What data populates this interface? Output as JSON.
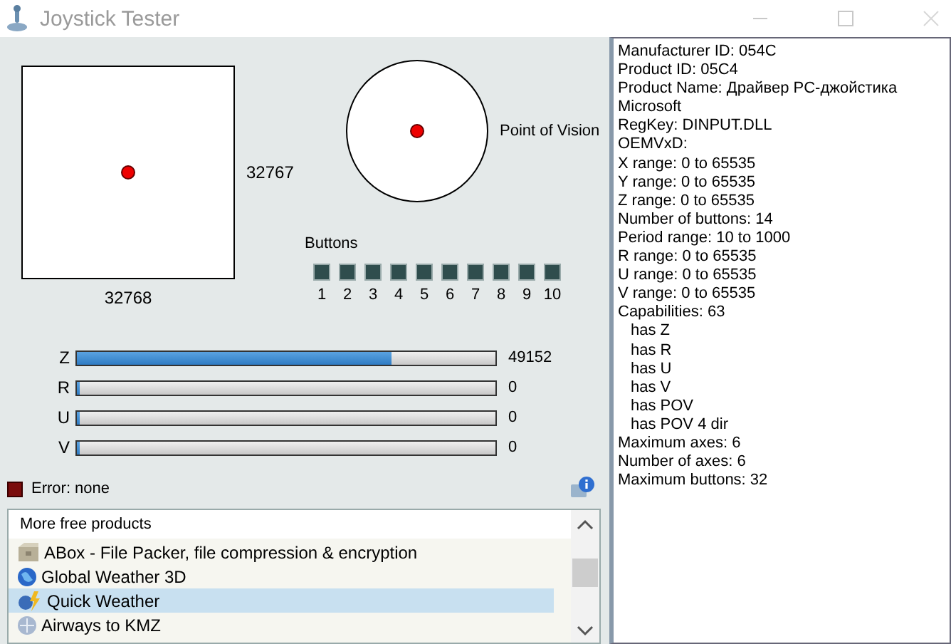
{
  "window": {
    "title": "Joystick Tester"
  },
  "xy_pad": {
    "x_reading": "32768",
    "y_reading": "32767"
  },
  "pov": {
    "label": "Point of Vision"
  },
  "buttons": {
    "label": "Buttons",
    "items": [
      {
        "label": "1",
        "pressed": false
      },
      {
        "label": "2",
        "pressed": false
      },
      {
        "label": "3",
        "pressed": false
      },
      {
        "label": "4",
        "pressed": false
      },
      {
        "label": "5",
        "pressed": false
      },
      {
        "label": "6",
        "pressed": false
      },
      {
        "label": "7",
        "pressed": false
      },
      {
        "label": "8",
        "pressed": false
      },
      {
        "label": "9",
        "pressed": false
      },
      {
        "label": "10",
        "pressed": false
      }
    ]
  },
  "axes": [
    {
      "name": "Z",
      "level": 0.75,
      "reading": "49152"
    },
    {
      "name": "R",
      "level": 0,
      "reading": "0"
    },
    {
      "name": "U",
      "level": 0,
      "reading": "0"
    },
    {
      "name": "V",
      "level": 0,
      "reading": "0"
    }
  ],
  "status": {
    "text": "Error: none"
  },
  "products": {
    "header": "More free products",
    "items": [
      {
        "label": "ABox - File Packer, file compression & encryption",
        "kind": "box",
        "selected": false
      },
      {
        "label": "Global Weather 3D",
        "kind": "globe",
        "selected": false
      },
      {
        "label": "Quick Weather",
        "kind": "weather",
        "selected": true
      },
      {
        "label": "Airways to KMZ",
        "kind": "plane",
        "selected": false
      }
    ]
  },
  "info": [
    {
      "text": "Manufacturer ID: 054C"
    },
    {
      "text": "Product ID: 05C4"
    },
    {
      "text": "Product Name: Драйвер PC-джойстика"
    },
    {
      "text": "Microsoft"
    },
    {
      "text": "RegKey: DINPUT.DLL"
    },
    {
      "text": "OEMVxD:"
    },
    {
      "text": "X range: 0 to 65535"
    },
    {
      "text": "Y range: 0 to 65535"
    },
    {
      "text": "Z range: 0 to 65535"
    },
    {
      "text": "Number of buttons: 14"
    },
    {
      "text": "Period range: 10 to 1000"
    },
    {
      "text": "R range: 0 to 65535"
    },
    {
      "text": "U range: 0 to 65535"
    },
    {
      "text": "V range: 0 to 65535"
    },
    {
      "text": "Capabilities: 63",
      "children": [
        {
          "text": "has Z"
        },
        {
          "text": "has R"
        },
        {
          "text": "has U"
        },
        {
          "text": "has V"
        },
        {
          "text": "has POV"
        },
        {
          "text": "has POV 4 dir"
        }
      ]
    },
    {
      "text": "Maximum axes: 6"
    },
    {
      "text": "Number of axes: 6"
    },
    {
      "text": "Maximum buttons: 32"
    }
  ]
}
